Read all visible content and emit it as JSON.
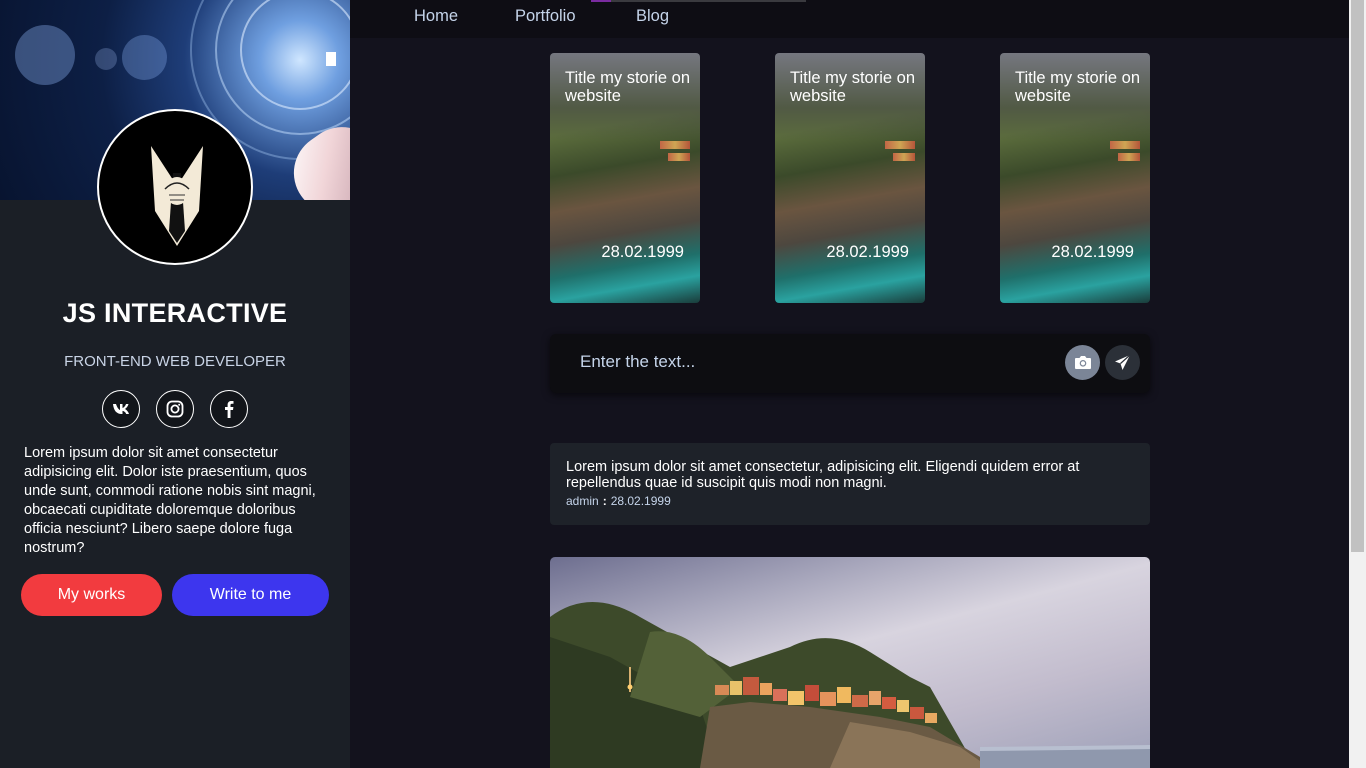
{
  "sidebar": {
    "brand_name": "JS INTERACTIVE",
    "role": "FRONT-END WEB DEVELOPER",
    "socials": [
      {
        "icon": "vk-icon"
      },
      {
        "icon": "instagram-icon"
      },
      {
        "icon": "facebook-icon"
      }
    ],
    "bio": "Lorem ipsum dolor sit amet consectetur adipisicing elit. Dolor iste praesentium, quos unde sunt, commodi ratione nobis sint magni, obcaecati cupiditate doloremque doloribus officia nesciunt? Libero saepe dolore fuga nostrum?",
    "buttons": {
      "works_label": "My works",
      "write_label": "Write to me"
    }
  },
  "nav": {
    "items": [
      "Home",
      "Portfolio",
      "Blog"
    ]
  },
  "stories": [
    {
      "title": "Title my storie on website",
      "date": "28.02.1999"
    },
    {
      "title": "Title my storie on website",
      "date": "28.02.1999"
    },
    {
      "title": "Title my storie on website",
      "date": "28.02.1999"
    }
  ],
  "composer": {
    "placeholder": "Enter the text...",
    "camera_icon": "camera-icon",
    "send_icon": "send-icon"
  },
  "post": {
    "text": "Lorem ipsum dolor sit amet consectetur, adipisicing elit. Eligendi quidem error at repellendus quae id suscipit quis modi non magni.",
    "author": "admin",
    "separator": ":",
    "date": "28.02.1999"
  },
  "colors": {
    "background": "#13121d",
    "sidebar": "#1b1f26",
    "accent_red": "#f23b3f",
    "accent_blue": "#3d36ee",
    "nav_text": "#c5d4ea"
  }
}
